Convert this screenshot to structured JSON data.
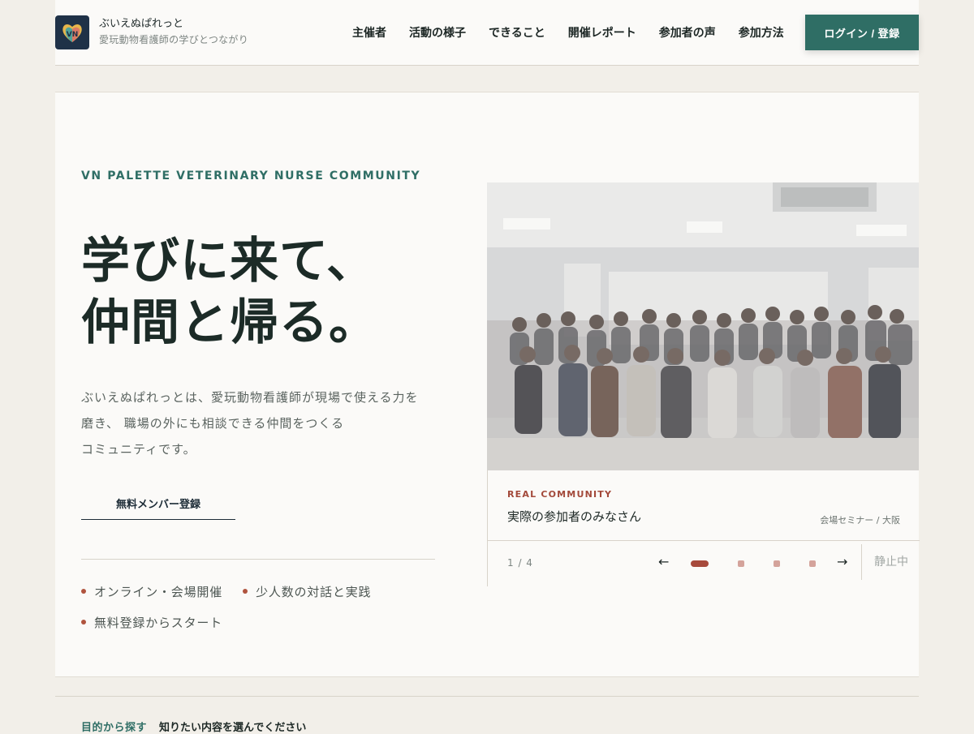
{
  "header": {
    "brand_name": "ぶいえぬぱれっと",
    "brand_sub": "愛玩動物看護師の学びとつながり",
    "logo_text": "VN",
    "nav": [
      "主催者",
      "活動の様子",
      "できること",
      "開催レポート",
      "参加者の声",
      "参加方法"
    ],
    "login_label": "ログイン / 登録"
  },
  "hero": {
    "eyebrow": "VN PALETTE  VETERINARY NURSE COMMUNITY",
    "headline_line1": "学びに来て、",
    "headline_line2": "仲間と帰る。",
    "lead_line1": "ぶいえぬぱれっとは、愛玩動物看護師が現場で使える力を",
    "lead_line2": "磨き、 職場の外にも相談できる仲間をつくる",
    "lead_line3": "コミュニティです。",
    "cta_label": "無料メンバー登録",
    "points": [
      "オンライン・会場開催",
      "少人数の対話と実践",
      "無料登録からスタート"
    ]
  },
  "slider": {
    "tag": "REAL COMMUNITY",
    "title": "実際の参加者のみなさん",
    "meta": "会場セミナー / 大阪",
    "counter": "1 / 4",
    "prev": "←",
    "next": "→",
    "pause_label": "静止中",
    "active_index": 1,
    "total": 4
  },
  "bottom": {
    "label": "目的から探す",
    "text": "知りたい内容を選んでください"
  },
  "colors": {
    "accent": "#2f6e65",
    "rust": "#a74a3c",
    "background": "#f2efe9",
    "card": "#fbfaf8"
  }
}
